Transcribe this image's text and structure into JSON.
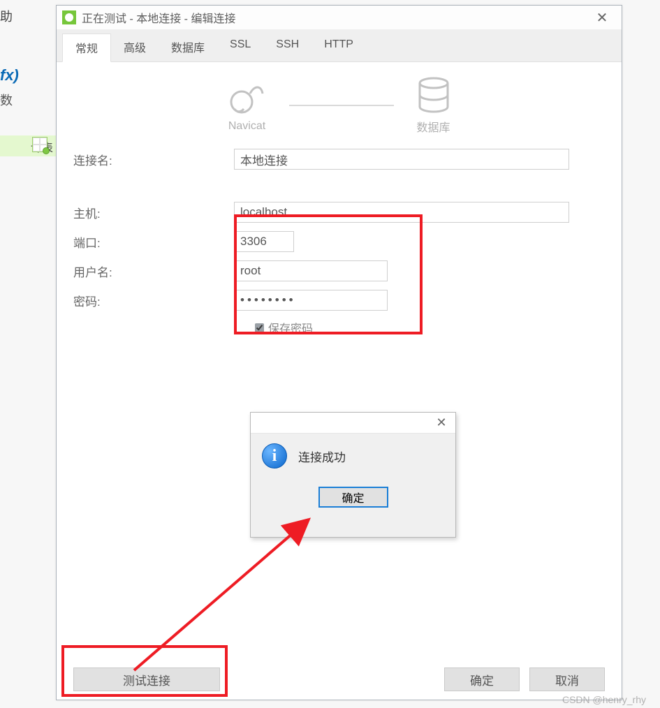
{
  "background": {
    "menu_help": "助",
    "fx": "fx)",
    "shu": "数",
    "design_table": "计表"
  },
  "window": {
    "title": "正在测试 - 本地连接 - 编辑连接"
  },
  "tabs": [
    {
      "id": "general",
      "label": "常规"
    },
    {
      "id": "advanced",
      "label": "高级"
    },
    {
      "id": "database",
      "label": "数据库"
    },
    {
      "id": "ssl",
      "label": "SSL"
    },
    {
      "id": "ssh",
      "label": "SSH"
    },
    {
      "id": "http",
      "label": "HTTP"
    }
  ],
  "header": {
    "left_label": "Navicat",
    "right_label": "数据库"
  },
  "form": {
    "conn_name_label": "连接名:",
    "conn_name_value": "本地连接",
    "host_label": "主机:",
    "host_value": "localhost",
    "port_label": "端口:",
    "port_value": "3306",
    "user_label": "用户名:",
    "user_value": "root",
    "pass_label": "密码:",
    "pass_value": "••••••••",
    "save_pass_label": "保存密码"
  },
  "msgbox": {
    "text": "连接成功",
    "ok": "确定"
  },
  "buttons": {
    "test": "测试连接",
    "ok": "确定",
    "cancel": "取消"
  },
  "watermark": "CSDN @henry_rhy"
}
